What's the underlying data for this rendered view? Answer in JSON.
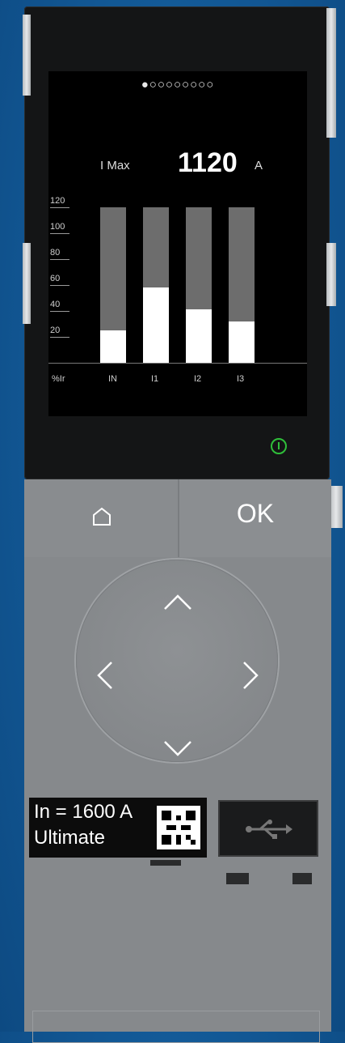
{
  "screen": {
    "page_dots": "●○○○○○○○○",
    "imax_label": "I Max",
    "imax_value": "1120",
    "imax_unit": "A"
  },
  "chart_data": {
    "type": "bar",
    "categories": [
      "IN",
      "I1",
      "I2",
      "I3"
    ],
    "values": [
      25,
      58,
      41,
      32
    ],
    "ylabel": "%Ir",
    "yticks": [
      "20",
      "40",
      "60",
      "80",
      "100",
      "120"
    ],
    "ylim": [
      0,
      120
    ],
    "bar_background_color": "#6d6d6d",
    "bar_fill_color": "#ffffff"
  },
  "buttons": {
    "home_icon": "home-icon",
    "ok_label": "OK"
  },
  "nav": {
    "up_icon": "chevron-up-icon",
    "down_icon": "chevron-down-icon",
    "left_icon": "chevron-left-icon",
    "right_icon": "chevron-right-icon"
  },
  "rating": {
    "line1": "In = 1600 A",
    "line2": "Ultimate"
  },
  "usb_icon": "usb-icon",
  "status_colors": {
    "power": "#2fbf3a"
  }
}
